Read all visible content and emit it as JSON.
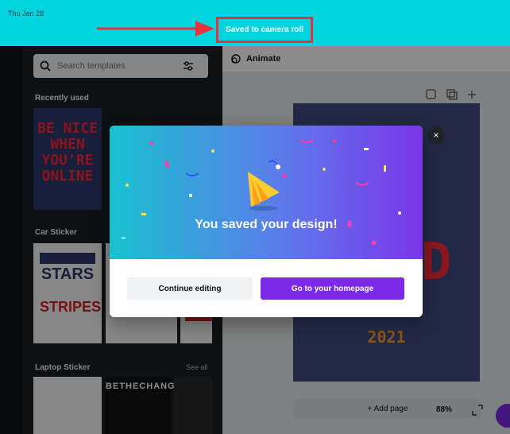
{
  "status_bar": {
    "time": "Thu Jan 28"
  },
  "banner": {
    "text": "Saved to camera roll"
  },
  "left_panel": {
    "search_placeholder": "Search templates",
    "sections": [
      {
        "title": "Recently used"
      },
      {
        "title": "Car Sticker"
      },
      {
        "title": "Laptop Sticker",
        "see_all": "See all"
      }
    ],
    "thumb_benice_text": "BE NICE WHEN YOU'RE ONLINE",
    "thumb_stars_text": "STARS",
    "thumb_stripes_text": "STRIPES",
    "thumb_laptop_text": "BETHECHANGE"
  },
  "editor": {
    "animate_label": "Animate",
    "poster_year": "2021",
    "poster_bigletter": "D",
    "add_page_label": "+ Add page",
    "zoom": "88%"
  },
  "modal": {
    "title": "You saved your design!",
    "continue_label": "Continue editing",
    "homepage_label": "Go to your homepage",
    "close_glyph": "×"
  },
  "colors": {
    "banner": "#00d4de",
    "highlight": "#e8333f",
    "brand_purple": "#7d2ae8"
  }
}
